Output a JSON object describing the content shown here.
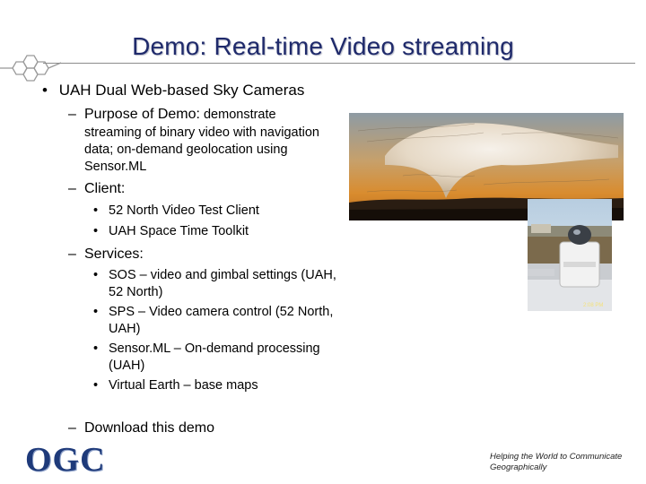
{
  "slide": {
    "title": "Demo: Real-time Video streaming",
    "main_bullet": "UAH Dual Web-based Sky Cameras",
    "purpose_heading": "Purpose of Demo:",
    "purpose_text_1": " demonstrate",
    "purpose_text_2": "streaming of binary video with navigation",
    "purpose_text_3": "data; on-demand geolocation using",
    "purpose_text_4": "Sensor.ML",
    "client_heading": "Client:",
    "client_items": [
      "52 North Video Test Client",
      "UAH Space Time Toolkit"
    ],
    "services_heading": "Services:",
    "service_1_line1": "SOS – video and gimbal settings (UAH,",
    "service_1_line2": "52 North)",
    "service_2_line1": "SPS – Video camera control (52 North,",
    "service_2_line2": "UAH)",
    "service_3_line1": "Sensor.ML – On-demand processing",
    "service_3_line2": "(UAH)",
    "service_4": "Virtual Earth – base maps",
    "download": "Download this demo",
    "dash": "–",
    "bullet": "•"
  },
  "footer": {
    "logo_text": "OGC",
    "tagline_1": "Helping the World to Communicate",
    "tagline_2": "Geographically"
  },
  "camera_photo": {
    "timestamp": "2:08 PM"
  },
  "colors": {
    "title": "#1f2a6b",
    "logo": "#1e3a7a"
  }
}
